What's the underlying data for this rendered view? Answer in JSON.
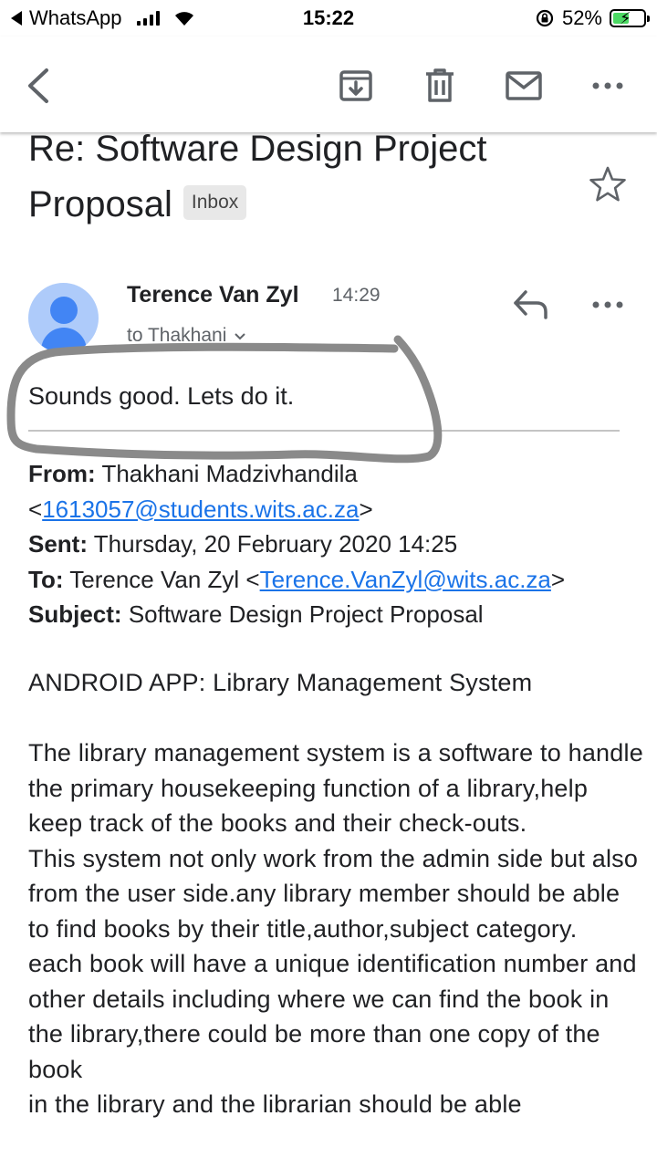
{
  "status_bar": {
    "back_app": "WhatsApp",
    "time": "15:22",
    "battery_percent": "52%",
    "battery_level": 0.52,
    "icons": [
      "back-triangle-icon",
      "signal-icon",
      "wifi-icon",
      "rotation-lock-icon",
      "battery-charging-icon"
    ]
  },
  "toolbar": {
    "icons": [
      "back-arrow-icon",
      "archive-icon",
      "trash-icon",
      "mail-icon",
      "more-icon"
    ]
  },
  "email": {
    "subject": "Re: Software Design Project Proposal",
    "label": "Inbox",
    "sender": "Terence Van Zyl",
    "time": "14:29",
    "recipient": "to Thakhani",
    "reply_text": "Sounds good. Lets do it.",
    "quoted_header": {
      "from_label": "From:",
      "from_name": "Thakhani Madzivhandila",
      "from_email": "1613057@students.wits.ac.za",
      "sent_label": "Sent:",
      "sent_value": "Thursday, 20 February 2020 14:25",
      "to_label": "To:",
      "to_name": "Terence Van Zyl",
      "to_email": "Terence.VanZyl@wits.ac.za",
      "subject_label": "Subject:",
      "subject_value": "Software Design Project Proposal"
    },
    "body_title": "ANDROID APP: Library Management System",
    "body_paragraphs": [
      "The library management system is a software to handle the primary housekeeping function of a library,help keep track of the books and their check-outs.",
      "This system not only work from the admin side but also from the user side.any library member should be able to find books by their title,author,subject category.",
      "each book will have a unique identification number and other details including where we can find the book in the library,there could be more than one copy of the book",
      "in the library and the librarian should be able"
    ]
  },
  "colors": {
    "link": "#1a73e8",
    "avatar_bg": "#aecbfa",
    "avatar_fg": "#4285f4",
    "annotation_stroke": "#8a8a8a",
    "battery_fill": "#4cd964"
  }
}
